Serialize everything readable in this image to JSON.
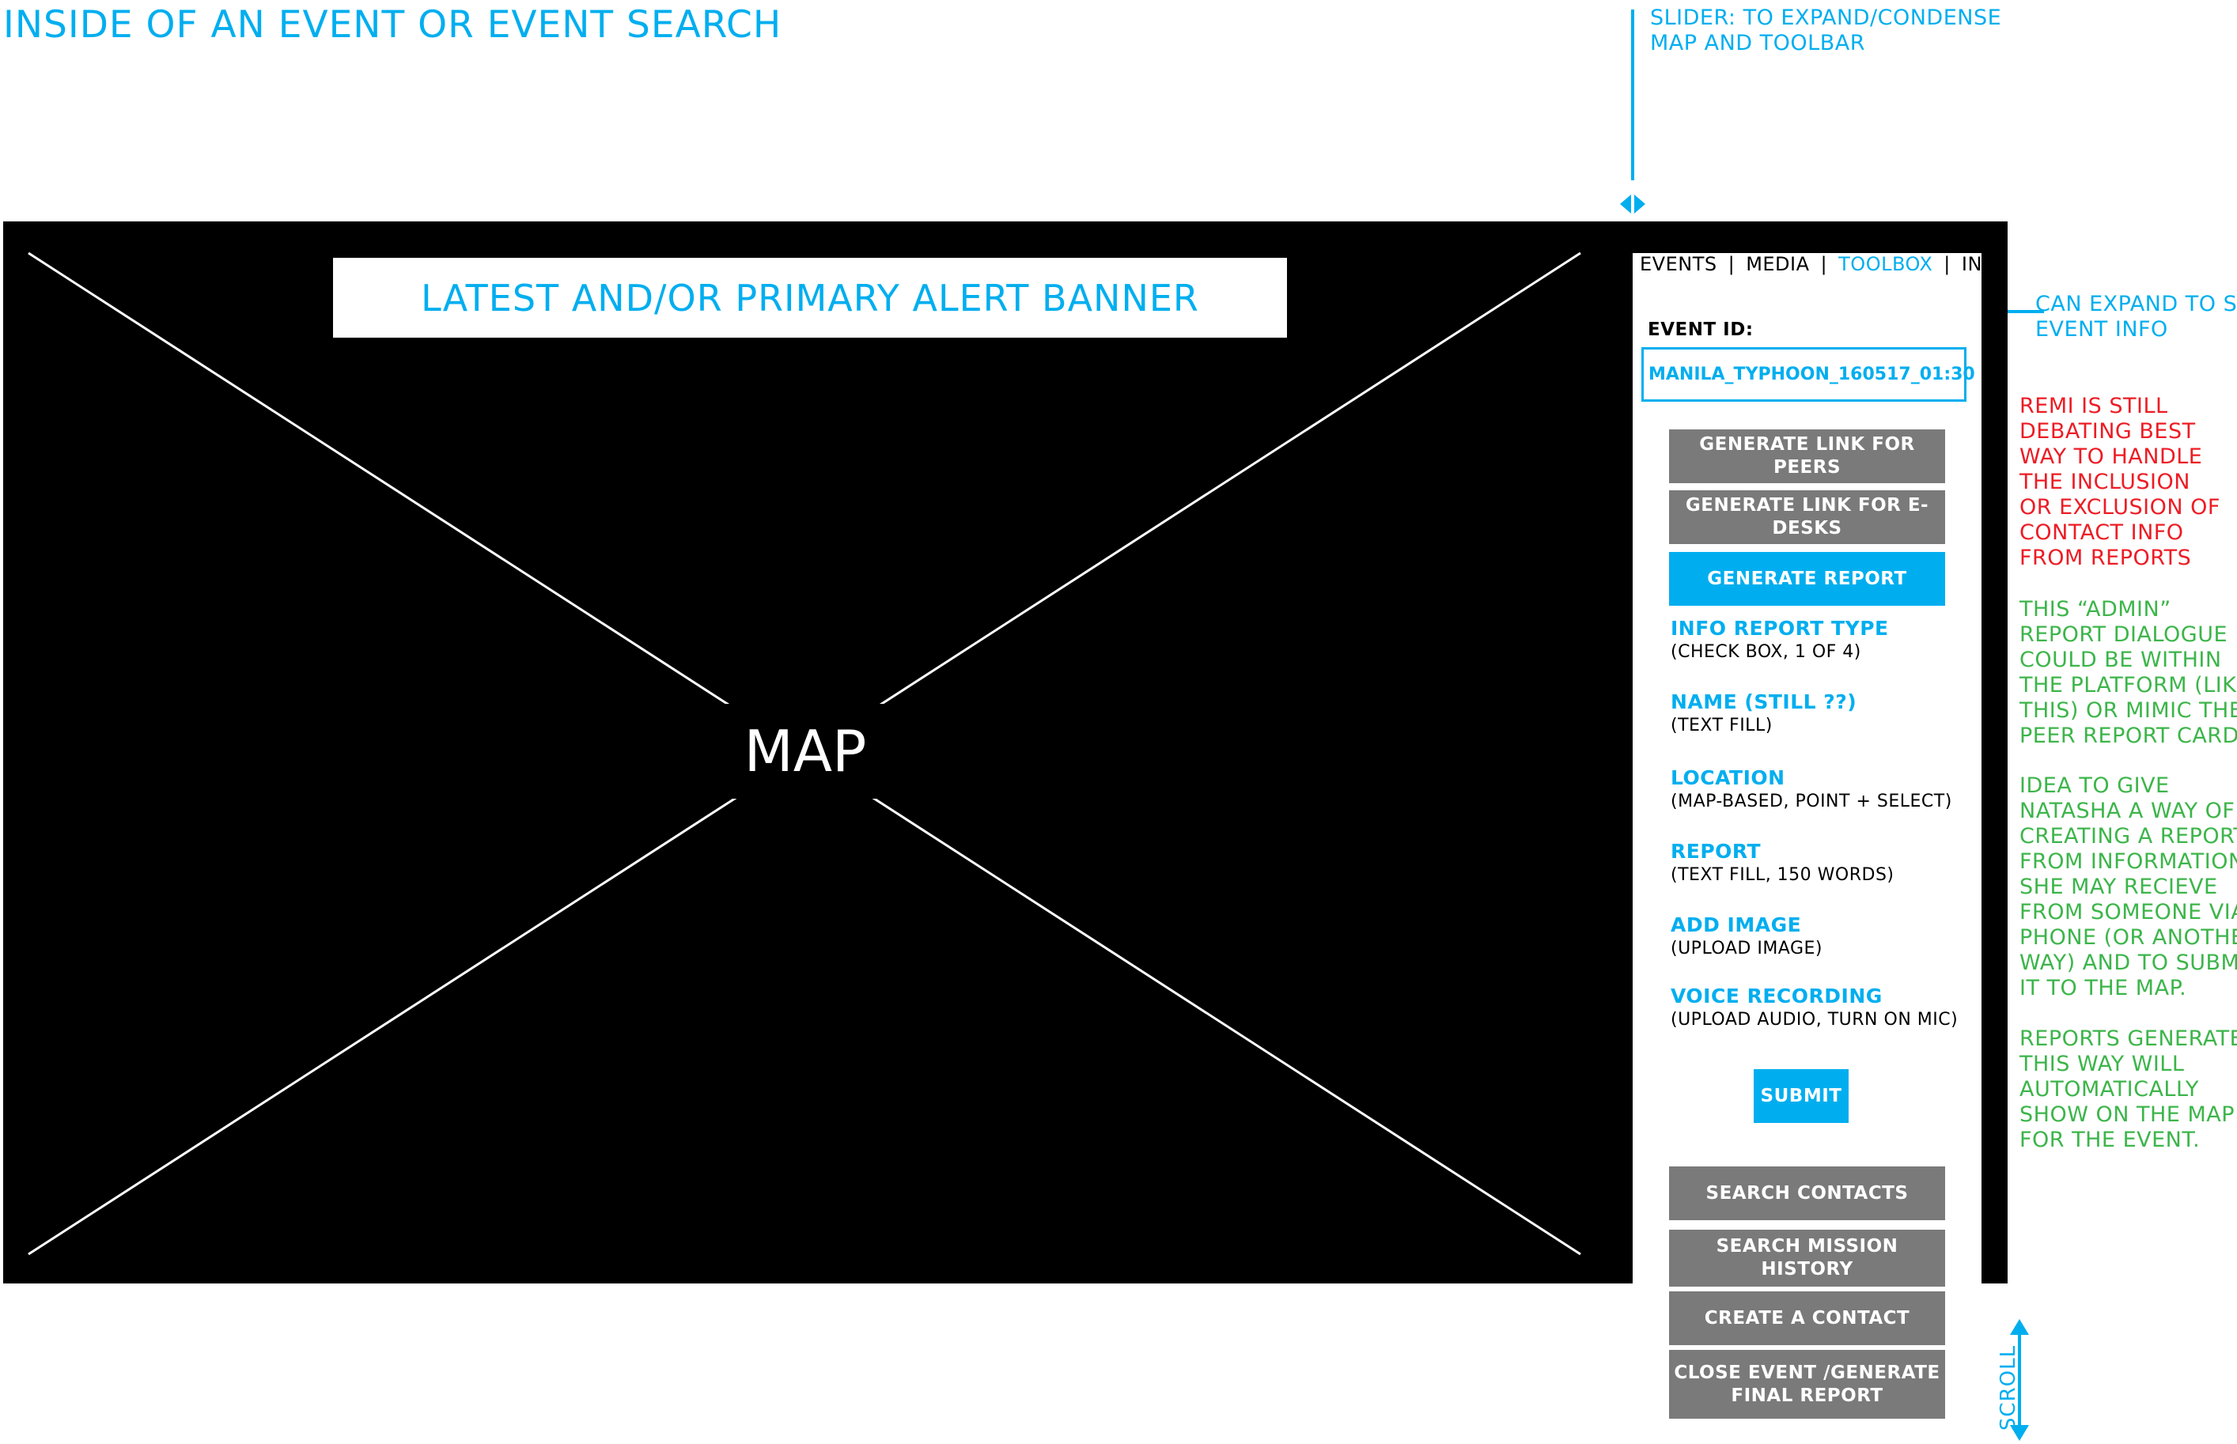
{
  "page": {
    "title": "INSIDE OF AN EVENT OR EVENT SEARCH"
  },
  "annotations": {
    "slider": [
      "SLIDER: TO EXPAND/CONDENSE",
      "MAP AND TOOLBAR"
    ],
    "expand": [
      "CAN EXPAND TO SEE",
      "EVENT INFO"
    ],
    "scroll": "SCROLL",
    "notes_red": [
      "REMI IS STILL",
      "DEBATING BEST",
      "WAY TO HANDLE",
      "THE INCLUSION",
      "OR EXCLUSION OF",
      "CONTACT INFO",
      "FROM REPORTS"
    ],
    "notes_green_1": [
      "THIS “ADMIN”",
      "REPORT DIALOGUE",
      "COULD BE WITHIN",
      "THE PLATFORM (LIKE",
      "THIS) OR MIMIC THE",
      "PEER REPORT CARDS."
    ],
    "notes_green_2": [
      "IDEA TO GIVE",
      "NATASHA A WAY OF",
      "CREATING A REPORT",
      "FROM INFORMATION",
      "SHE MAY RECIEVE",
      "FROM SOMEONE VIA",
      "PHONE (OR ANOTHER",
      "WAY) AND TO SUBMIT",
      "IT TO THE MAP."
    ],
    "notes_green_3": [
      "REPORTS GENERATED",
      "THIS WAY WILL",
      "AUTOMATICALLY",
      "SHOW ON THE MAP",
      "FOR THE EVENT."
    ]
  },
  "map": {
    "label": "MAP",
    "alert_banner": "LATEST AND/OR PRIMARY ALERT BANNER"
  },
  "toolbar": {
    "tabs": [
      "EVENTS",
      "MEDIA",
      "TOOLBOX",
      "INFO"
    ],
    "active_tab": "TOOLBOX",
    "separator": "|",
    "event_id_label": "EVENT ID:",
    "event_id_value": "MANILA_TYPHOON_160517_01:30",
    "buttons": {
      "link_peers": "GENERATE LINK FOR PEERS",
      "link_edesks": "GENERATE LINK FOR E-DESKS",
      "generate_report": "GENERATE REPORT",
      "submit": "SUBMIT",
      "search_contacts": "SEARCH CONTACTS",
      "search_mission_history": "SEARCH MISSION HISTORY",
      "create_contact": "CREATE A CONTACT",
      "close_event": [
        "CLOSE EVENT /GENERATE",
        "FINAL REPORT"
      ]
    },
    "fields": [
      {
        "title": "INFO REPORT TYPE",
        "desc": "(CHECK BOX, 1 OF 4)"
      },
      {
        "title": "NAME (STILL ??)",
        "desc": "(TEXT FILL)"
      },
      {
        "title": "LOCATION",
        "desc": "(MAP-BASED, POINT + SELECT)"
      },
      {
        "title": "REPORT",
        "desc": "(TEXT FILL, 150 WORDS)"
      },
      {
        "title": "ADD IMAGE",
        "desc": "(UPLOAD IMAGE)"
      },
      {
        "title": "VOICE RECORDING",
        "desc": "(UPLOAD AUDIO, TURN ON MIC)"
      }
    ]
  },
  "colors": {
    "accent": "#00aeef",
    "green_note": "#3cb54a",
    "red_note": "#ed1c24",
    "button_gray": "#7a7a7a",
    "map_bg": "#000000"
  }
}
